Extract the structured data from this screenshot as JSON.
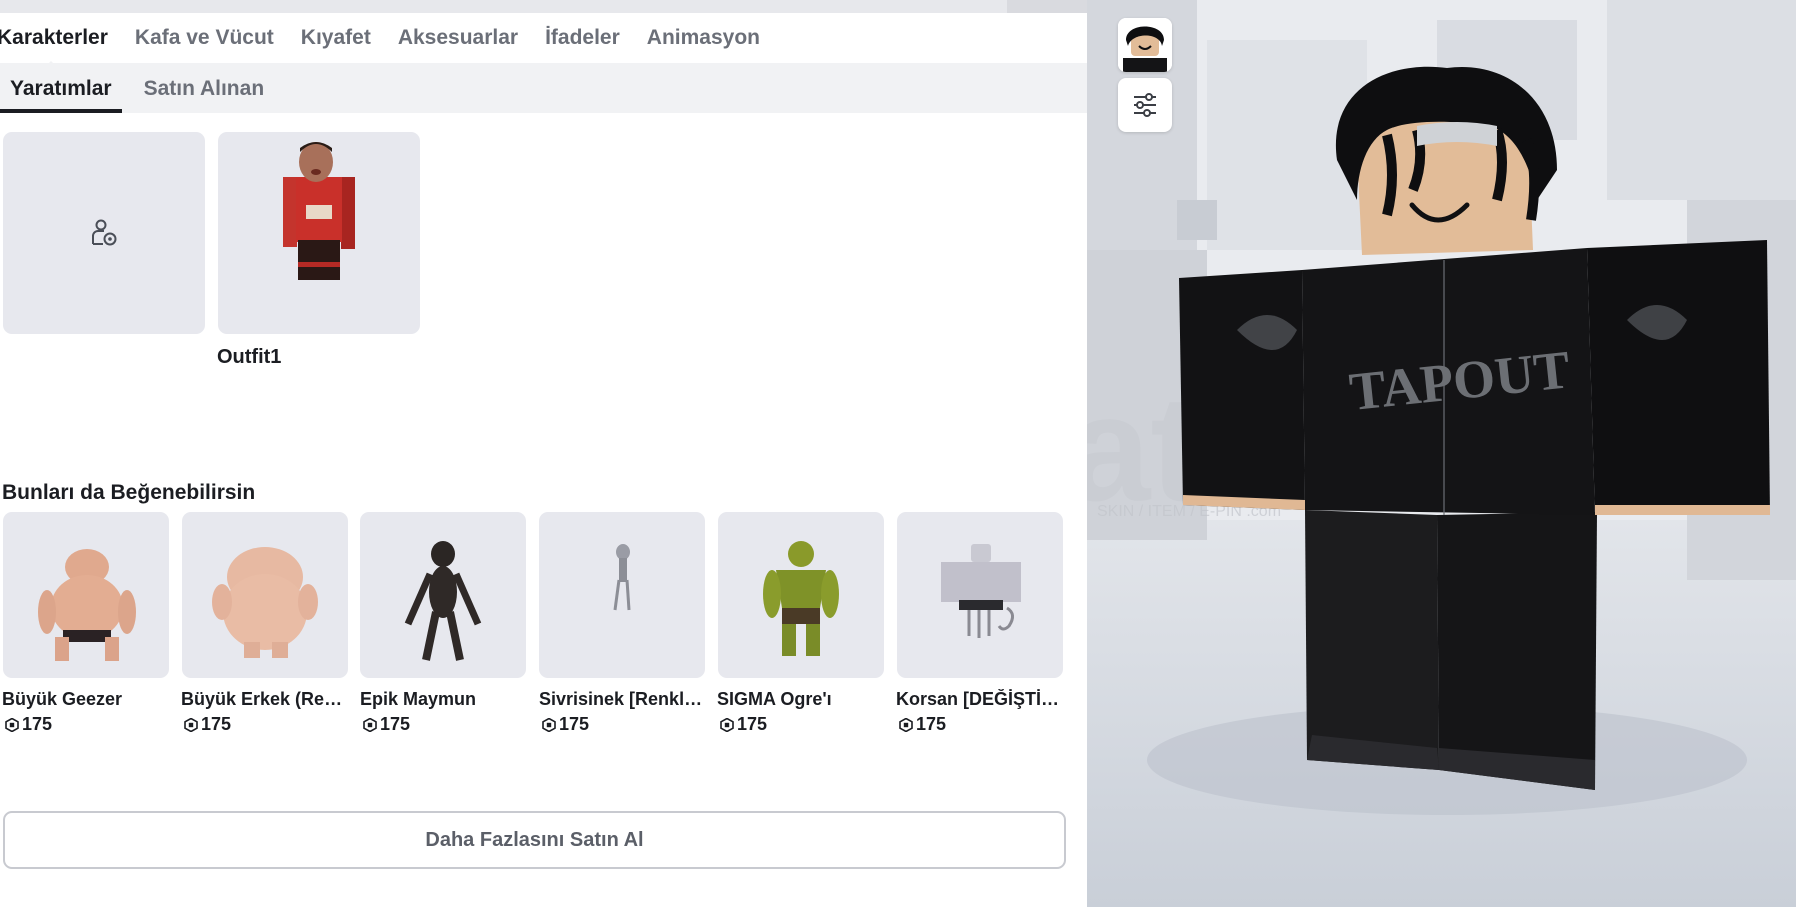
{
  "category_tabs": [
    {
      "label": "Karakterler",
      "active": true
    },
    {
      "label": "Kafa ve Vücut",
      "active": false
    },
    {
      "label": "Kıyafet",
      "active": false
    },
    {
      "label": "Aksesuarlar",
      "active": false
    },
    {
      "label": "İfadeler",
      "active": false
    },
    {
      "label": "Animasyon",
      "active": false
    }
  ],
  "sub_tabs": [
    {
      "label": "Yaratımlar",
      "active": true
    },
    {
      "label": "Satın Alınan",
      "active": false
    }
  ],
  "creations": {
    "create_icon": "create-character-icon",
    "items": [
      {
        "label": "Outfit1"
      }
    ]
  },
  "recommendations": {
    "title": "Bunları da Beğenebilirsin",
    "currency_icon": "robux-icon",
    "items": [
      {
        "name": "Büyük Geezer",
        "price": "175"
      },
      {
        "name": "Büyük Erkek (Renk...",
        "price": "175"
      },
      {
        "name": "Epik Maymun",
        "price": "175"
      },
      {
        "name": "Sivrisinek [Renkle...",
        "price": "175"
      },
      {
        "name": "SIGMA Ogre'ı",
        "price": "175"
      },
      {
        "name": "Korsan [DEĞİŞTİRİ...",
        "price": "175"
      }
    ]
  },
  "more_button": {
    "label": "Daha Fazlasını Satın Al"
  },
  "viewport": {
    "watermark": "atis",
    "watermark_sub": "SKIN / ITEM / E-PIN  .com",
    "shirt_text": "TAPOUT",
    "settings_icon": "sliders-icon"
  },
  "colors": {
    "accent": "#1b1d22",
    "card_bg": "#e7e8ee",
    "subtab_bg": "#f1f2f4"
  }
}
